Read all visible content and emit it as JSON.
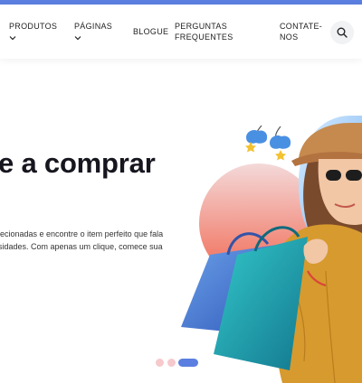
{
  "nav": {
    "items": [
      {
        "label": "PRODUTOS",
        "has_dropdown": true
      },
      {
        "label": "PÁGINAS",
        "has_dropdown": true
      },
      {
        "label": "BLOGUE",
        "has_dropdown": false
      },
      {
        "label": "PERGUNTAS FREQUENTES",
        "has_dropdown": false
      },
      {
        "label": "CONTATE-NOS",
        "has_dropdown": false
      }
    ],
    "search_icon": "search-icon"
  },
  "hero": {
    "headline": "e a comprar",
    "body_line_1": "lecionadas e encontre o item perfeito que fala",
    "body_line_2": "sidades. Com apenas um clique, comece sua"
  },
  "carousel": {
    "slide_count": 3,
    "active_index": 2
  },
  "colors": {
    "accent": "#5b7fe0",
    "inactive_dot": "#f6c9cc",
    "circle_gradient_top": "#f3d6d6",
    "circle_gradient_bottom": "#f26d57"
  }
}
